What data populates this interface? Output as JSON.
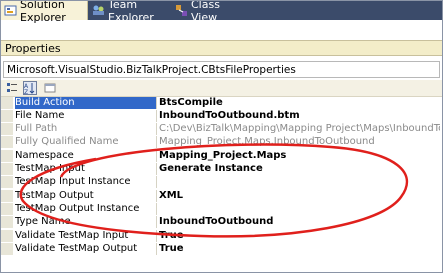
{
  "tabs": [
    {
      "label": "Solution Explorer",
      "icon": "solution-explorer-icon",
      "active": true
    },
    {
      "label": "Team Explorer",
      "icon": "team-explorer-icon",
      "active": false
    },
    {
      "label": "Class View",
      "icon": "class-view-icon",
      "active": false
    }
  ],
  "properties_title": "Properties",
  "object_selector": "Microsoft.VisualStudio.BizTalkProject.CBtsFileProperties",
  "toolbar": {
    "icons": [
      "categorized-icon",
      "alphabetical-icon",
      "property-pages-icon"
    ]
  },
  "rows": [
    {
      "name": "Build Action",
      "value": "BtsCompile",
      "bold": true,
      "gray": false,
      "selected": true
    },
    {
      "name": "File Name",
      "value": "InboundToOutbound.btm",
      "bold": true,
      "gray": false,
      "selected": false
    },
    {
      "name": "Full Path",
      "value": "C:\\Dev\\BizTalk\\Mapping\\Mapping Project\\Maps\\InboundToOutbound.btm",
      "bold": false,
      "gray": true,
      "selected": false
    },
    {
      "name": "Fully Qualified Name",
      "value": "Mapping_Project.Maps.InboundToOutbound",
      "bold": false,
      "gray": true,
      "selected": false
    },
    {
      "name": "Namespace",
      "value": "Mapping_Project.Maps",
      "bold": true,
      "gray": false,
      "selected": false
    },
    {
      "name": "TestMap Input",
      "value": "Generate Instance",
      "bold": true,
      "gray": false,
      "selected": false
    },
    {
      "name": "TestMap Input Instance",
      "value": "",
      "bold": false,
      "gray": false,
      "selected": false
    },
    {
      "name": "TestMap Output",
      "value": "XML",
      "bold": true,
      "gray": false,
      "selected": false
    },
    {
      "name": "TestMap Output Instance",
      "value": "",
      "bold": false,
      "gray": false,
      "selected": false
    },
    {
      "name": "Type Name",
      "value": "InboundToOutbound",
      "bold": true,
      "gray": false,
      "selected": false
    },
    {
      "name": "Validate TestMap Input",
      "value": "True",
      "bold": true,
      "gray": false,
      "selected": false
    },
    {
      "name": "Validate TestMap Output",
      "value": "True",
      "bold": true,
      "gray": false,
      "selected": false
    }
  ],
  "colors": {
    "tabstrip": "#3b4b6a",
    "selected_row": "#3168c9",
    "annotation_oval": "#e0201c"
  }
}
